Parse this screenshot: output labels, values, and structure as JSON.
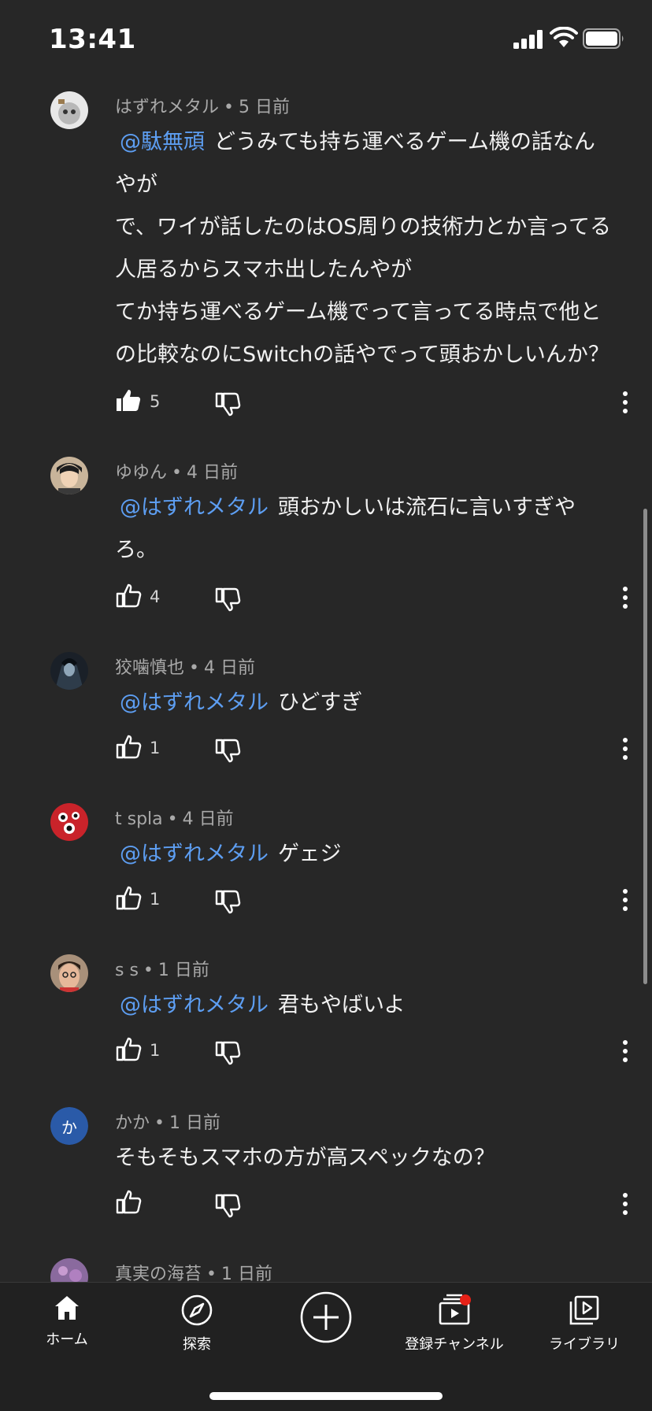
{
  "status_bar": {
    "time": "13:41"
  },
  "comments": [
    {
      "author": "はずれメタル",
      "time": "5 日前",
      "mention": "@駄無頑",
      "text_lines": [
        "どうみても持ち運べるゲーム機の話なん",
        "やが",
        "で、ワイが話したのはOS周りの技術力とか言ってる",
        "人居るからスマホ出したんやが",
        "てか持ち運べるゲーム機でって言ってる時点で他と",
        "の比較なのにSwitchの話やでって頭おかしいんか？"
      ],
      "likes": "5"
    },
    {
      "author": "ゆゆん",
      "time": "4 日前",
      "mention": "@はずれメタル",
      "text_lines": [
        "頭おかしいは流石に言いすぎや",
        "ろ。"
      ],
      "likes": "4"
    },
    {
      "author": "狡噛慎也",
      "time": "4 日前",
      "mention": "@はずれメタル",
      "text_lines": [
        "ひどすぎ"
      ],
      "likes": "1"
    },
    {
      "author": "t spla",
      "time": "4 日前",
      "mention": "@はずれメタル",
      "text_lines": [
        "ゲェジ"
      ],
      "likes": "1"
    },
    {
      "author": "s s",
      "time": "1 日前",
      "mention": "@はずれメタル",
      "text_lines": [
        "君もやばいよ"
      ],
      "likes": "1"
    },
    {
      "author": "かか",
      "time": "1 日前",
      "avatar_letter": "か",
      "text_lines": [
        "そもそもスマホの方が高スペックなの？"
      ],
      "likes": ""
    },
    {
      "author": "真実の海苔",
      "time": "1 日前"
    }
  ],
  "separator": "•",
  "nav": {
    "home": "ホーム",
    "explore": "探索",
    "subscriptions": "登録チャンネル",
    "library": "ライブラリ"
  },
  "colors": {
    "background": "#272727",
    "mention": "#5d9ef2",
    "meta_text": "#a9a9a9",
    "notification_dot": "#e62117"
  }
}
